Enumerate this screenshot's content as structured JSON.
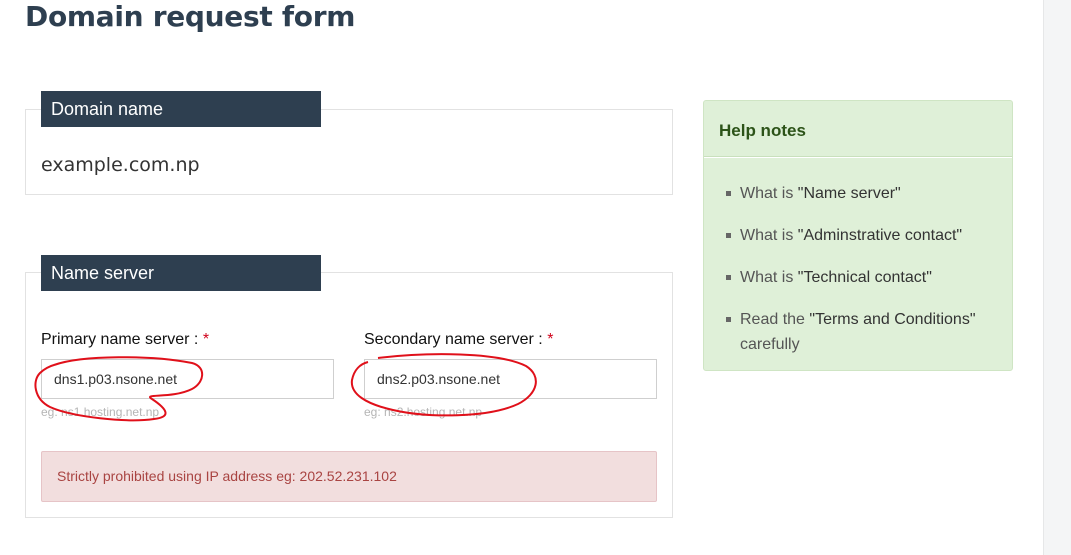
{
  "page": {
    "title": "Domain request form"
  },
  "domain_panel": {
    "heading": "Domain name",
    "value": "example.com.np"
  },
  "name_server_panel": {
    "heading": "Name server",
    "primary": {
      "label": "Primary name server : ",
      "required_mark": "*",
      "value": "dns1.p03.nsone.net",
      "hint": "eg: ns1.hosting.net.np"
    },
    "secondary": {
      "label": "Secondary name server : ",
      "required_mark": "*",
      "value": "dns2.p03.nsone.net",
      "hint": "eg: ns2.hosting.net.np"
    },
    "warning": "Strictly prohibited using IP address eg: 202.52.231.102"
  },
  "help": {
    "title": "Help notes",
    "items": [
      {
        "prefix": "What is ",
        "link": "\"Name server\"",
        "suffix": ""
      },
      {
        "prefix": "What is ",
        "link": "\"Adminstrative contact\"",
        "suffix": ""
      },
      {
        "prefix": "What is ",
        "link": "\"Technical contact\"",
        "suffix": ""
      },
      {
        "prefix": "Read the ",
        "link": "\"Terms and Conditions\"",
        "suffix": " carefully"
      }
    ]
  },
  "colors": {
    "heading_bg": "#2e3f50",
    "help_bg": "#dff0d8",
    "alert_bg": "#f2dede",
    "required": "#d0021b",
    "annotation": "#e0101a"
  }
}
